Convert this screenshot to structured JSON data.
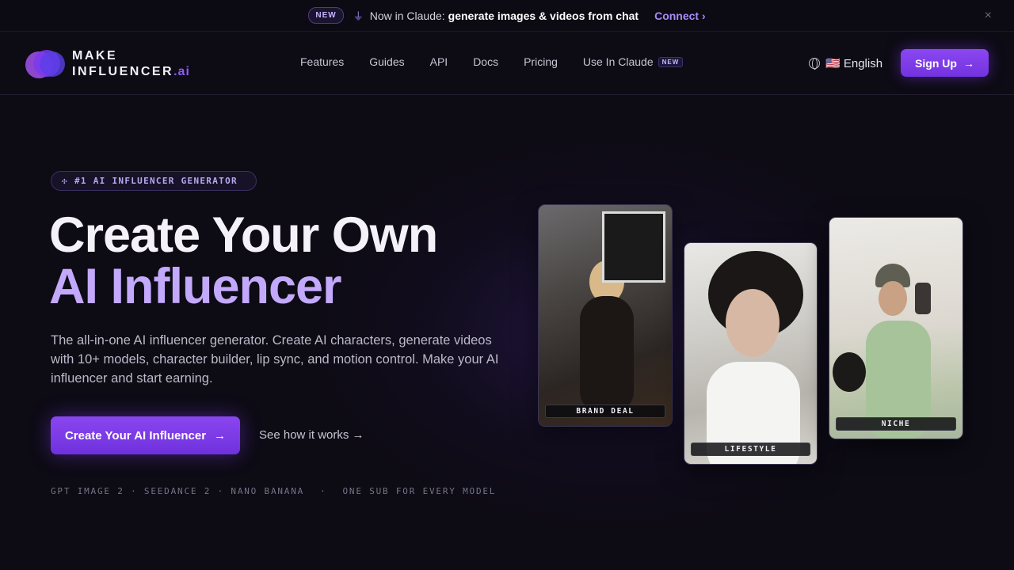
{
  "announcement": {
    "badge": "NEW",
    "lead": "Now in Claude:",
    "message": "generate images & videos from chat",
    "link": "Connect",
    "link_arrow": "›",
    "close_icon": "×"
  },
  "logo": {
    "line1": "MAKE",
    "line2": "INFLUENCER",
    "suffix": ".ai"
  },
  "nav": {
    "items": [
      {
        "label": "Features"
      },
      {
        "label": "Guides"
      },
      {
        "label": "API"
      },
      {
        "label": "Docs"
      },
      {
        "label": "Pricing"
      }
    ],
    "claude_label": "Use In Claude",
    "claude_tag": "NEW",
    "language": "🇺🇸 English",
    "signup": "Sign Up",
    "signup_arrow": "→"
  },
  "hero": {
    "badge": "#1 AI INFLUENCER GENERATOR",
    "title_line1": "Create Your Own",
    "title_line2": "AI Influencer",
    "subtitle": "The all-in-one AI influencer generator. Create AI characters, generate videos with 10+ models, character builder, lip sync, and motion control. Make your AI influencer and start earning.",
    "cta": "Create Your AI Influencer",
    "cta_arrow": "→",
    "secondary": "See how it works →",
    "models": "GPT IMAGE 2 · SEEDANCE 2 · NANO BANANA",
    "models_sep": "·",
    "models_tail": "ONE SUB FOR EVERY MODEL"
  },
  "cards": [
    {
      "label": "BRAND DEAL"
    },
    {
      "label": "LIFESTYLE"
    },
    {
      "label": "NICHE"
    }
  ],
  "colors": {
    "accent": "#7c3aed",
    "accent_light": "#a78bfa",
    "background": "#0d0b14"
  }
}
